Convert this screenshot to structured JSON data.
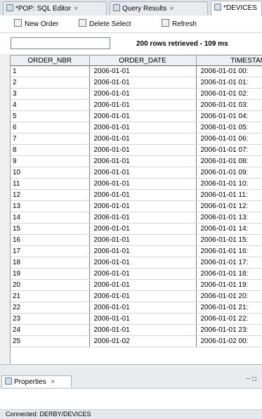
{
  "tabs": [
    {
      "label": "*POP: SQL Editor",
      "active": false
    },
    {
      "label": "Query Results",
      "active": false
    },
    {
      "label": "*DEVICES",
      "active": true
    }
  ],
  "toolbar": {
    "new_order_label": "New Order",
    "delete_selected_label": "Delete Select",
    "refresh_label": "Refresh"
  },
  "filter": {
    "value": "",
    "status": "200 rows retrieved - 109 ms"
  },
  "grid": {
    "columns": [
      "ORDER_NBR",
      "ORDER_DATE",
      "TIMESTAMP"
    ],
    "rows": [
      [
        "1",
        "2006-01-01",
        "2006-01-01 00:"
      ],
      [
        "2",
        "2006-01-01",
        "2006-01-01 01:"
      ],
      [
        "3",
        "2006-01-01",
        "2006-01-01 02:"
      ],
      [
        "4",
        "2006-01-01",
        "2006-01-01 03:"
      ],
      [
        "5",
        "2006-01-01",
        "2006-01-01 04:"
      ],
      [
        "6",
        "2006-01-01",
        "2006-01-01 05:"
      ],
      [
        "7",
        "2006-01-01",
        "2006-01-01 06:"
      ],
      [
        "8",
        "2006-01-01",
        "2006-01-01 07:"
      ],
      [
        "9",
        "2006-01-01",
        "2006-01-01 08:"
      ],
      [
        "10",
        "2006-01-01",
        "2006-01-01 09:"
      ],
      [
        "11",
        "2006-01-01",
        "2006-01-01 10:"
      ],
      [
        "12",
        "2006-01-01",
        "2006-01-01 11:"
      ],
      [
        "13",
        "2006-01-01",
        "2006-01-01 12:"
      ],
      [
        "14",
        "2006-01-01",
        "2006-01-01 13:"
      ],
      [
        "15",
        "2006-01-01",
        "2006-01-01 14:"
      ],
      [
        "16",
        "2006-01-01",
        "2006-01-01 15:"
      ],
      [
        "17",
        "2006-01-01",
        "2006-01-01 16:"
      ],
      [
        "18",
        "2006-01-01",
        "2006-01-01 17:"
      ],
      [
        "19",
        "2006-01-01",
        "2006-01-01 18:"
      ],
      [
        "20",
        "2006-01-01",
        "2006-01-01 19:"
      ],
      [
        "21",
        "2006-01-01",
        "2006-01-01 20:"
      ],
      [
        "22",
        "2006-01-01",
        "2006-01-01 21:"
      ],
      [
        "23",
        "2006-01-01",
        "2006-01-01 22:"
      ],
      [
        "24",
        "2006-01-01",
        "2006-01-01 23:"
      ],
      [
        "25",
        "2006-01-02",
        "2006-01-02 00:"
      ]
    ]
  },
  "bottom_panel": {
    "tab_label": "Properties",
    "tab_close": "×",
    "buttons": "− □"
  },
  "status_bar": {
    "text": "Connected: DERBY/DEVICES"
  },
  "colors": {
    "tab_bar": "#dfe3e8",
    "grid_background": "#ffffff",
    "grid_lines": "#d6d6d6"
  }
}
